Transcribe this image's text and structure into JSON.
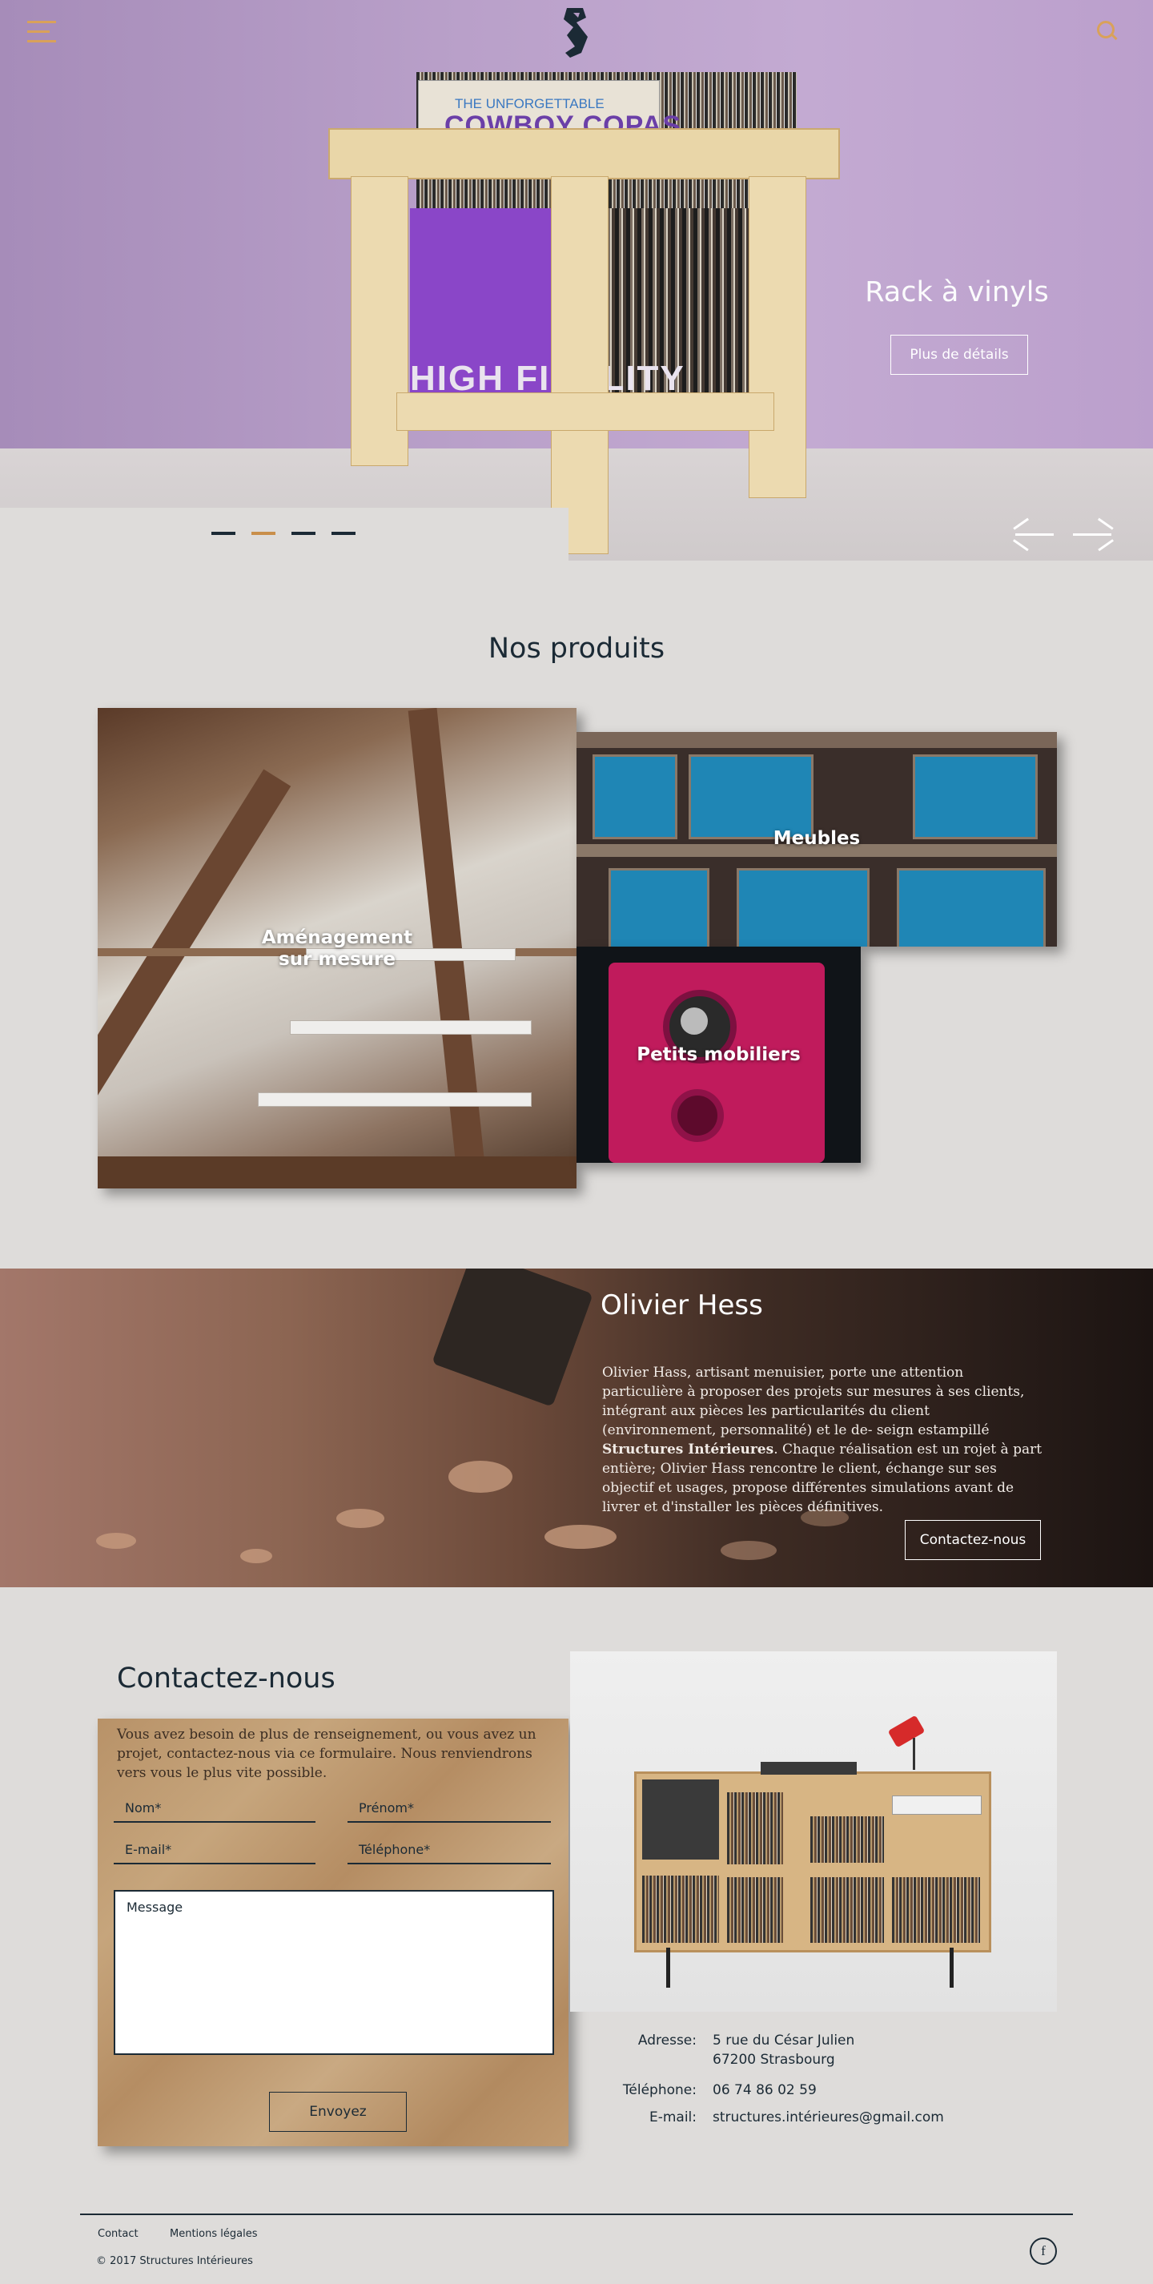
{
  "hero": {
    "title": "Rack à vinyls",
    "button_label": "Plus de détails",
    "album_title": "COWBOY COPAS",
    "album_subtitle": "THE UNFORGETTABLE",
    "sleeve_text": "HIGH FIDELITY",
    "slides": 4,
    "active_slide": 2
  },
  "header": {
    "menu_icon": "hamburger-icon",
    "search_icon": "search-icon",
    "accent_color": "#d9a15a"
  },
  "products": {
    "title": "Nos produits",
    "items": [
      {
        "label": "Aménagement\nsur mesure"
      },
      {
        "label": "Meubles"
      },
      {
        "label": "Petits mobiliers"
      }
    ]
  },
  "about": {
    "title": "Olivier Hess",
    "text_before": "Olivier Hass, artisant menuisier, porte une attention particulière à proposer des projets sur mesures à ses clients, intégrant aux pièces les particularités du client (environnement, personnalité) et le de- seign estampillé ",
    "text_bold": "Structures Intérieures",
    "text_after": ". Chaque réalisation est un rojet à part entière; Olivier Hass rencontre le client, échange sur ses objectif et usages, propose différentes simulations avant de livrer et d'installer les pièces définitives.",
    "button_label": "Contactez-nous"
  },
  "contact": {
    "title": "Contactez-nous",
    "intro": "Vous avez besoin de plus de renseignement, ou vous avez un projet, contactez-nous via ce formulaire. Nous renviendrons vers vous le plus vite possible.",
    "fields": {
      "nom": "Nom*",
      "prenom": "Prénom*",
      "email": "E-mail*",
      "telephone": "Téléphone*",
      "message": "Message"
    },
    "submit_label": "Envoyez",
    "info": {
      "address_label": "Adresse:",
      "address_line1": "5 rue du César Julien",
      "address_line2": "67200 Strasbourg",
      "phone_label": "Téléphone:",
      "phone": "06 74 86 02 59",
      "email_label": "E-mail:",
      "email": "structures.intérieures@gmail.com"
    }
  },
  "footer": {
    "links": [
      "Contact",
      "Mentions légales"
    ],
    "copyright": "© 2017 Structures Intérieures",
    "social_icon": "facebook-icon",
    "social_glyph": "f"
  }
}
